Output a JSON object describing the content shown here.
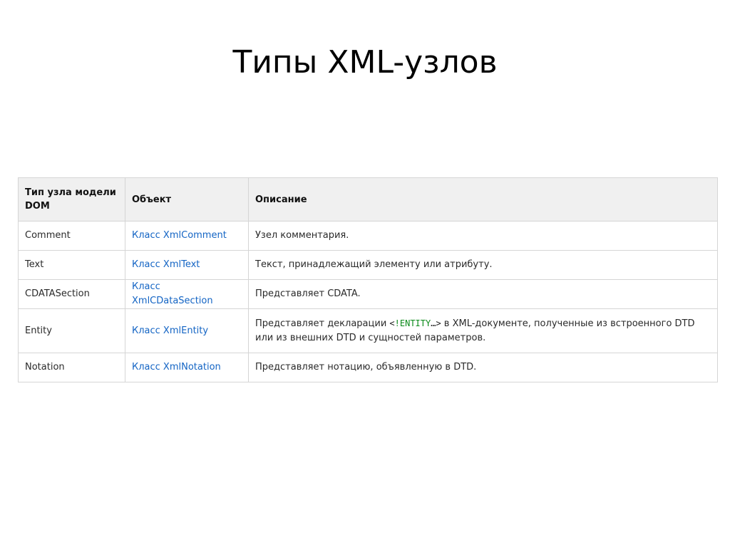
{
  "slide": {
    "title": "Типы XML-узлов"
  },
  "table": {
    "headers": [
      "Тип узла модели DOM",
      "Объект",
      "Описание"
    ],
    "rows": [
      {
        "type": "Comment",
        "object": "Класс XmlComment",
        "description": "Узел комментария."
      },
      {
        "type": "Text",
        "object": "Класс XmlText",
        "description": "Текст, принадлежащий элементу или атрибуту."
      },
      {
        "type": "CDATASection",
        "object": "Класс XmlCDataSection",
        "description": "Представляет CDATA."
      },
      {
        "type": "Entity",
        "object": "Класс XmlEntity",
        "description_before": "Представляет декларации ",
        "code_open": "<",
        "code_entity": "!ENTITY",
        "code_close": "…>",
        "description_after": " в XML-документе, полученные из встроенного DTD или из внешних DTD и сущностей параметров."
      },
      {
        "type": "Notation",
        "object": "Класс XmlNotation",
        "description": "Представляет нотацию, объявленную в DTD."
      }
    ]
  },
  "colors": {
    "link": "#1364c4",
    "header_bg": "#f0f0f0",
    "border": "#d5d5d5",
    "code_keyword": "#0b8a1a"
  }
}
